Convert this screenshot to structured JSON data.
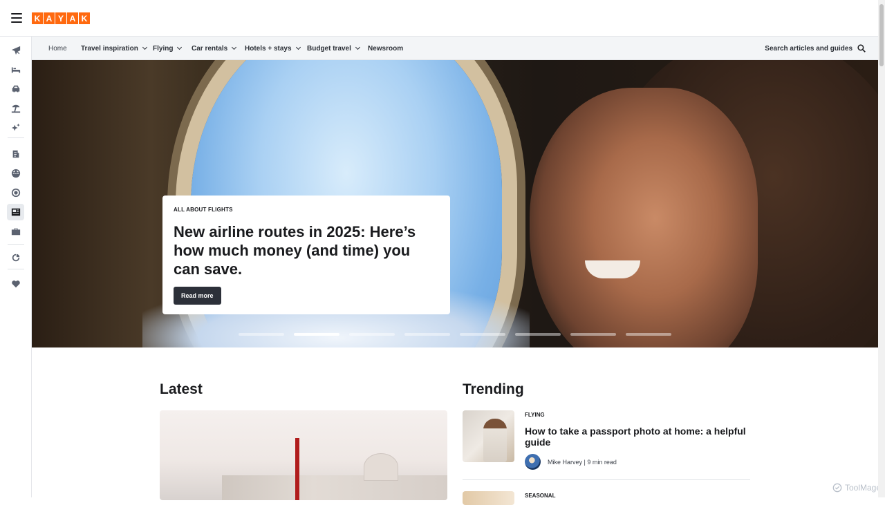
{
  "brand": {
    "logo_letters": [
      "K",
      "A",
      "Y",
      "A",
      "K"
    ],
    "accent": "#ff690f"
  },
  "rail": {
    "items": [
      {
        "name": "flights-icon"
      },
      {
        "name": "stays-icon"
      },
      {
        "name": "cars-icon"
      },
      {
        "name": "packages-icon"
      },
      {
        "name": "ai-mode-icon"
      },
      {
        "name": "trips-icon"
      },
      {
        "name": "explore-icon"
      },
      {
        "name": "trends-icon"
      },
      {
        "name": "guides-icon"
      },
      {
        "name": "business-icon"
      },
      {
        "name": "deals-icon"
      },
      {
        "name": "saved-icon"
      }
    ],
    "active_index": 8
  },
  "subnav": {
    "home": "Home",
    "travel_inspiration": "Travel inspiration",
    "flying": "Flying",
    "car_rentals": "Car rentals",
    "hotels_stays": "Hotels + stays",
    "budget_travel": "Budget travel",
    "newsroom": "Newsroom",
    "search_label": "Search articles and guides"
  },
  "hero": {
    "eyebrow": "ALL ABOUT FLIGHTS",
    "title": "New airline routes in 2025: Here’s how much money (and time) you can save.",
    "cta": "Read more",
    "slide_count": 8,
    "active_slide": 1
  },
  "latest": {
    "heading": "Latest"
  },
  "trending": {
    "heading": "Trending",
    "items": [
      {
        "category": "FLYING",
        "title": "How to take a passport photo at home: a helpful guide",
        "author": "Mike Harvey | 9 min read"
      },
      {
        "category": "SEASONAL"
      }
    ]
  },
  "watermark": "ToolMage"
}
